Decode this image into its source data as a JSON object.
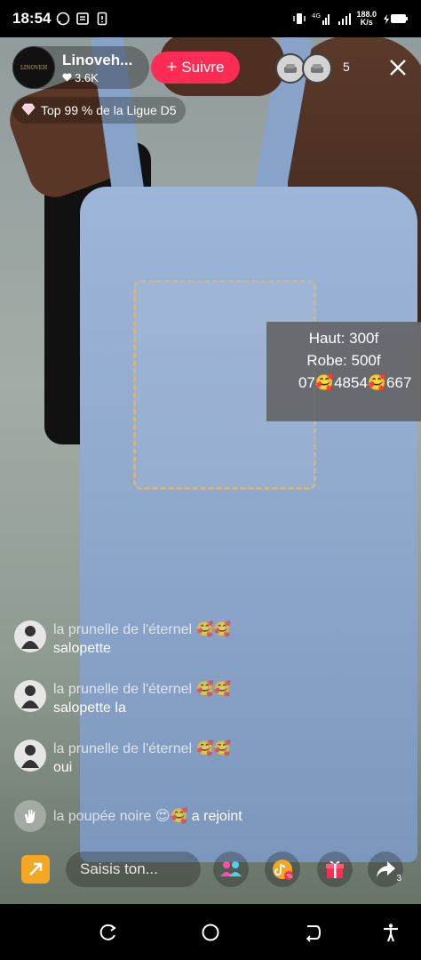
{
  "status_bar": {
    "time": "18:54",
    "network": "4G",
    "speed_value": "188.0",
    "speed_unit": "K/s"
  },
  "host": {
    "name": "Linoveh...",
    "likes": "3.6K",
    "avatar_text": "LINOVEH"
  },
  "follow_button": {
    "label": "Suivre"
  },
  "viewers": {
    "count": "5"
  },
  "league": {
    "label": "Top 99 % de la Ligue D5"
  },
  "price_overlay": {
    "line1": "Haut: 300f",
    "line2": "Robe: 500f",
    "line3": "07🥰4854🥰667"
  },
  "comments": [
    {
      "user": "la prunelle de l'éternel 🥰🥰",
      "message": "salopette"
    },
    {
      "user": "la prunelle de l'éternel 🥰🥰",
      "message": "salopette la"
    },
    {
      "user": "la prunelle de l'éternel 🥰🥰",
      "message": "oui"
    }
  ],
  "join_event": {
    "user": "la poupée noire 😍🥰",
    "action": " a rejoint"
  },
  "bottom_bar": {
    "comment_placeholder": "Saisis ton...",
    "share_count": "3"
  },
  "colors": {
    "accent": "#fe2c55",
    "status_bar_bg": "#000000",
    "price_bg": "#5f5f5f"
  }
}
